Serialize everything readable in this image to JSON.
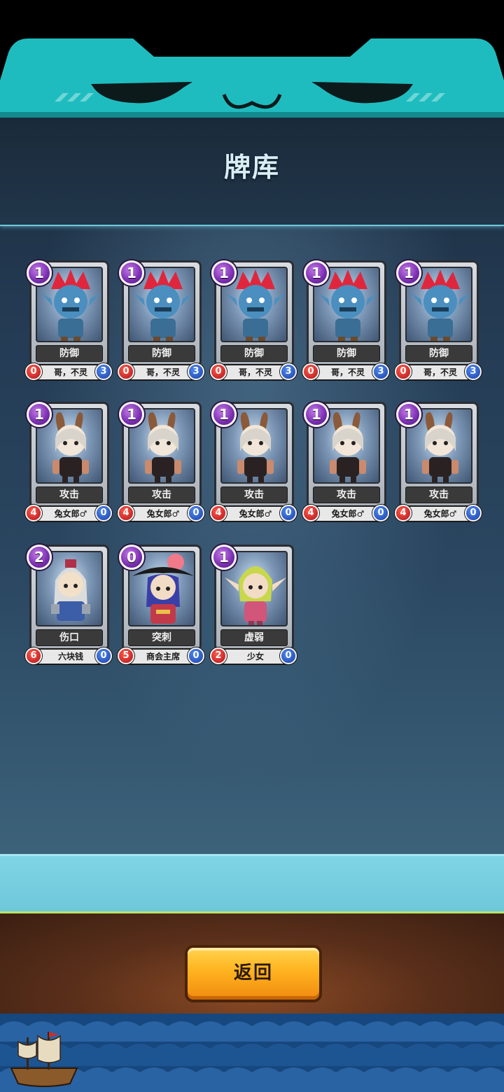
{
  "screen": {
    "title": "牌库",
    "back_button": "返回"
  },
  "colors": {
    "header_teal": "#1fbcbf",
    "panel_dark": "#1c2c3d",
    "cost_purple": "#7a2db0",
    "stat_red": "#d1222a",
    "stat_blue": "#2a52c8",
    "button_orange": "#ffb21f"
  },
  "cards": [
    {
      "cost": "1",
      "name": "防御",
      "owner": "哥，不灵",
      "left": "0",
      "right": "3",
      "art": "troll-icon"
    },
    {
      "cost": "1",
      "name": "防御",
      "owner": "哥，不灵",
      "left": "0",
      "right": "3",
      "art": "troll-icon"
    },
    {
      "cost": "1",
      "name": "防御",
      "owner": "哥，不灵",
      "left": "0",
      "right": "3",
      "art": "troll-icon"
    },
    {
      "cost": "1",
      "name": "防御",
      "owner": "哥，不灵",
      "left": "0",
      "right": "3",
      "art": "troll-icon"
    },
    {
      "cost": "1",
      "name": "防御",
      "owner": "哥，不灵",
      "left": "0",
      "right": "3",
      "art": "troll-icon"
    },
    {
      "cost": "1",
      "name": "攻击",
      "owner": "兔女郎♂",
      "left": "4",
      "right": "0",
      "art": "bunny-icon"
    },
    {
      "cost": "1",
      "name": "攻击",
      "owner": "兔女郎♂",
      "left": "4",
      "right": "0",
      "art": "bunny-icon"
    },
    {
      "cost": "1",
      "name": "攻击",
      "owner": "兔女郎♂",
      "left": "4",
      "right": "0",
      "art": "bunny-icon"
    },
    {
      "cost": "1",
      "name": "攻击",
      "owner": "兔女郎♂",
      "left": "4",
      "right": "0",
      "art": "bunny-icon"
    },
    {
      "cost": "1",
      "name": "攻击",
      "owner": "兔女郎♂",
      "left": "4",
      "right": "0",
      "art": "bunny-icon"
    },
    {
      "cost": "2",
      "name": "伤口",
      "owner": "六块钱",
      "left": "6",
      "right": "0",
      "art": "knight-icon"
    },
    {
      "cost": "0",
      "name": "突刺",
      "owner": "商会主席",
      "left": "5",
      "right": "0",
      "art": "pirate-icon"
    },
    {
      "cost": "1",
      "name": "虚弱",
      "owner": "少女",
      "left": "2",
      "right": "0",
      "art": "elf-icon"
    }
  ]
}
